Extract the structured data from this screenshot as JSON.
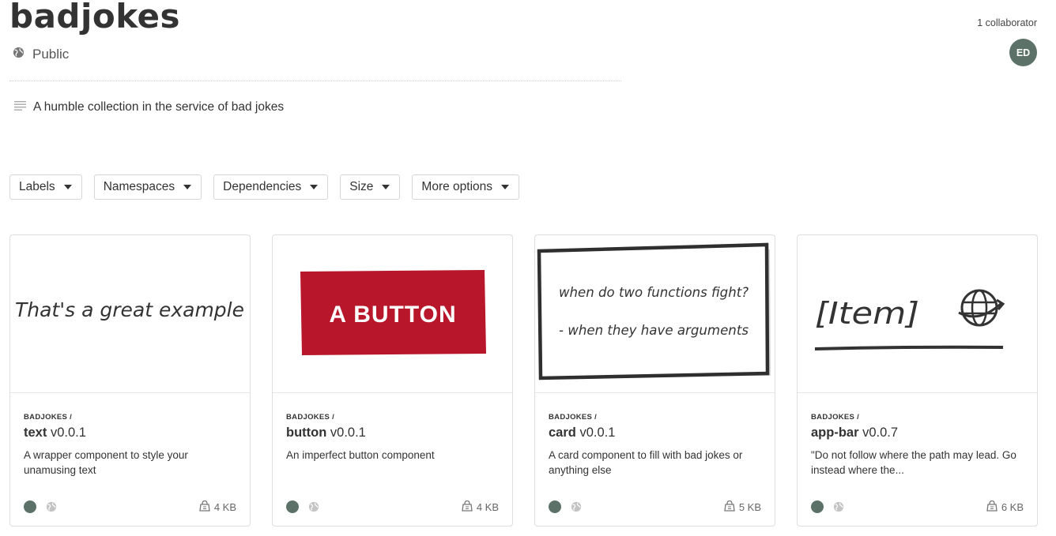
{
  "collection": {
    "title": "badjokes",
    "visibility": "Public",
    "description": "A humble collection in the service of bad jokes"
  },
  "collaborators": {
    "count_label": "1 collaborator",
    "avatar_initials": "ED"
  },
  "filters": [
    {
      "label": "Labels"
    },
    {
      "label": "Namespaces"
    },
    {
      "label": "Dependencies"
    },
    {
      "label": "Size"
    },
    {
      "label": "More options"
    }
  ],
  "colors": {
    "avatar": "#5c7268",
    "button_preview": "#b8162b"
  },
  "cards": [
    {
      "scope": "BADJOKES /",
      "name": "text",
      "version": "v0.0.1",
      "description": "A wrapper component to style your unamusing text",
      "size": "4 KB",
      "preview_text": "That's a great example",
      "icons": [
        "status-dot",
        "globe-icon",
        "package-size-icon"
      ]
    },
    {
      "scope": "BADJOKES /",
      "name": "button",
      "version": "v0.0.1",
      "description": "An imperfect button component",
      "size": "4 KB",
      "preview_text": "A BUTTON",
      "icons": [
        "status-dot",
        "globe-icon",
        "package-size-icon"
      ]
    },
    {
      "scope": "BADJOKES /",
      "name": "card",
      "version": "v0.0.1",
      "description": "A card component to fill with bad jokes or anything else",
      "size": "5 KB",
      "preview_line1": "when do two functions fight?",
      "preview_line2": "- when they have arguments",
      "icons": [
        "status-dot",
        "globe-icon",
        "package-size-icon"
      ]
    },
    {
      "scope": "BADJOKES /",
      "name": "app-bar",
      "version": "v0.0.7",
      "description": "\"Do not follow where the path may lead. Go instead where the...",
      "size": "6 KB",
      "preview_text": "[Item]",
      "icons": [
        "status-dot",
        "globe-icon",
        "package-size-icon"
      ]
    }
  ]
}
